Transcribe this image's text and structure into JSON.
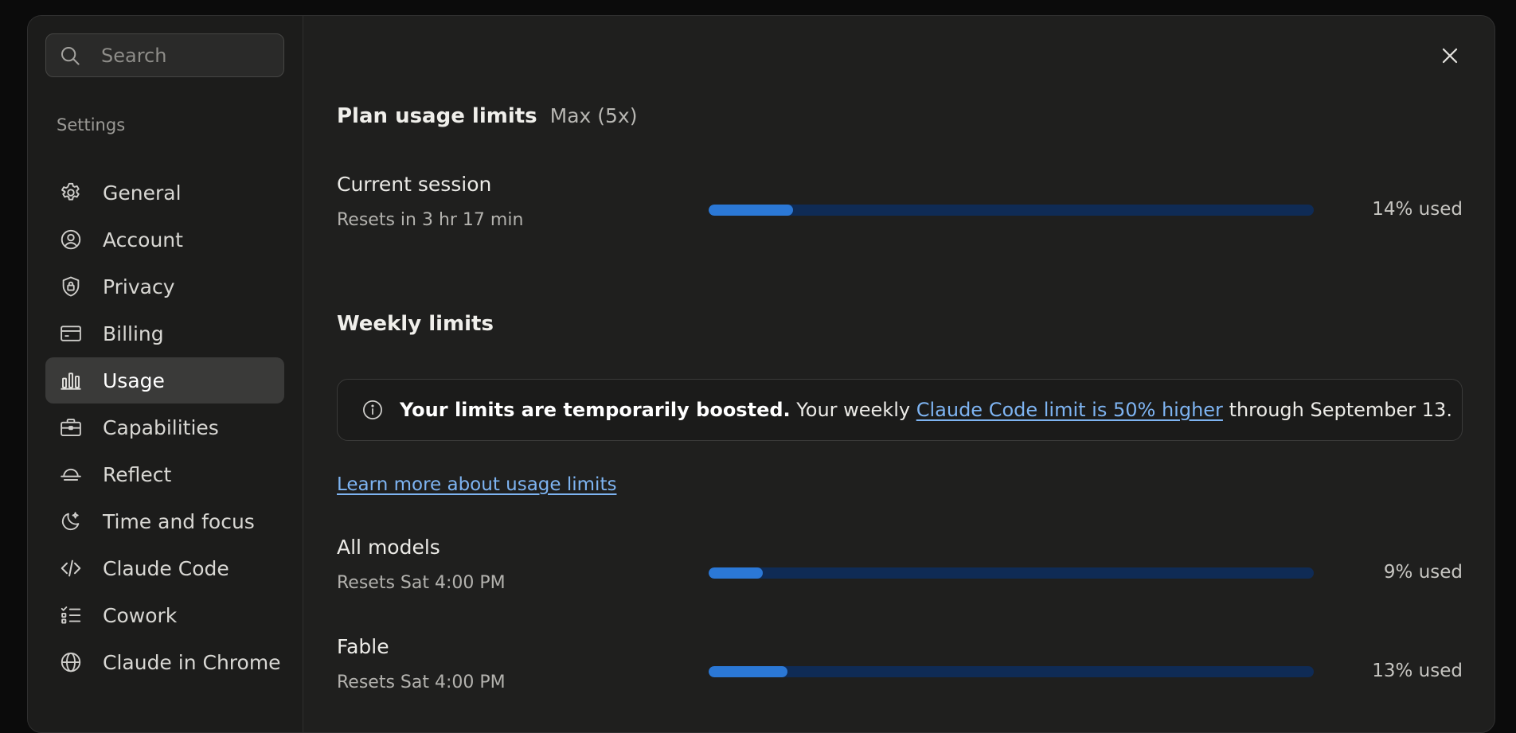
{
  "search": {
    "placeholder": "Search"
  },
  "sidebar": {
    "section_label": "Settings",
    "items": [
      {
        "label": "General",
        "icon": "gear-icon"
      },
      {
        "label": "Account",
        "icon": "user-circle-icon"
      },
      {
        "label": "Privacy",
        "icon": "shield-lock-icon"
      },
      {
        "label": "Billing",
        "icon": "credit-card-icon"
      },
      {
        "label": "Usage",
        "icon": "bar-chart-icon",
        "active": true
      },
      {
        "label": "Capabilities",
        "icon": "briefcase-icon"
      },
      {
        "label": "Reflect",
        "icon": "horizon-icon"
      },
      {
        "label": "Time and focus",
        "icon": "moon-star-icon"
      },
      {
        "label": "Claude Code",
        "icon": "code-icon"
      },
      {
        "label": "Cowork",
        "icon": "checklist-icon"
      },
      {
        "label": "Claude in Chrome",
        "icon": "globe-icon"
      }
    ]
  },
  "main": {
    "title": "Plan usage limits",
    "plan": "Max (5x)",
    "current_session": {
      "title": "Current session",
      "reset": "Resets in 3 hr 17 min",
      "percent": 14,
      "percent_label": "14% used"
    },
    "weekly_title": "Weekly limits",
    "banner": {
      "bold": "Your limits are temporarily boosted.",
      "text_before": "Your weekly",
      "link": "Claude Code limit is 50% higher",
      "text_after": "through September 13."
    },
    "learn_more": "Learn more about usage limits",
    "limits": [
      {
        "title": "All models",
        "reset": "Resets Sat 4:00 PM",
        "percent": 9,
        "percent_label": "9% used"
      },
      {
        "title": "Fable",
        "reset": "Resets Sat 4:00 PM",
        "percent": 13,
        "percent_label": "13% used"
      }
    ]
  },
  "colors": {
    "accent": "#2b78d6",
    "track": "#0f2b55",
    "link": "#7eb4f2"
  }
}
